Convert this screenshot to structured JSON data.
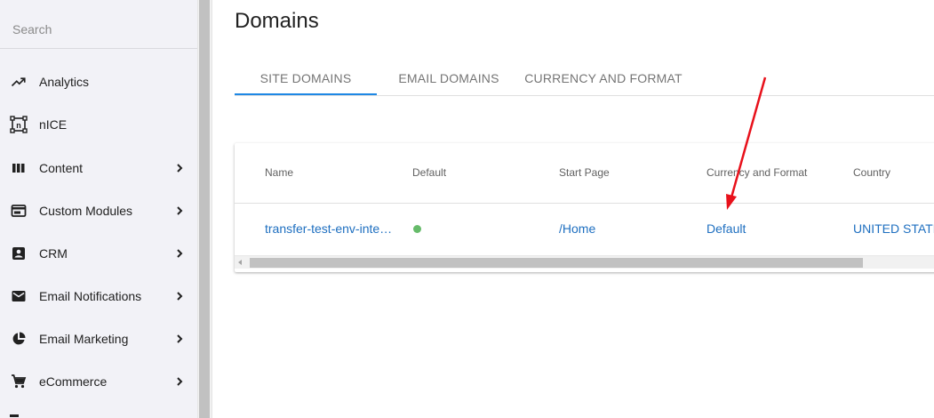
{
  "sidebar": {
    "search_placeholder": "Search",
    "items": [
      {
        "label": "Analytics",
        "icon": "trending-up-icon",
        "has_submenu": false
      },
      {
        "label": "nICE",
        "icon": "nice-icon",
        "has_submenu": false
      },
      {
        "label": "Content",
        "icon": "columns-icon",
        "has_submenu": true
      },
      {
        "label": "Custom Modules",
        "icon": "web-module-icon",
        "has_submenu": true
      },
      {
        "label": "CRM",
        "icon": "contact-card-icon",
        "has_submenu": true
      },
      {
        "label": "Email Notifications",
        "icon": "email-icon",
        "has_submenu": true
      },
      {
        "label": "Email Marketing",
        "icon": "pie-chart-icon",
        "has_submenu": true
      },
      {
        "label": "eCommerce",
        "icon": "cart-icon",
        "has_submenu": true
      }
    ]
  },
  "page": {
    "title": "Domains"
  },
  "tabs": [
    {
      "label": "SITE DOMAINS",
      "active": true
    },
    {
      "label": "EMAIL DOMAINS",
      "active": false
    },
    {
      "label": "CURRENCY AND FORMAT",
      "active": false
    }
  ],
  "table": {
    "columns": [
      "Name",
      "Default",
      "Start Page",
      "Currency and Format",
      "Country"
    ],
    "rows": [
      {
        "name": "transfer-test-env-inte…",
        "default": true,
        "start_page": "/Home",
        "currency_format": "Default",
        "country": "UNITED STATE"
      }
    ]
  },
  "colors": {
    "accent": "#1e88e5",
    "link": "#1e6fc0",
    "status_green": "#66bb6a",
    "annotation_arrow": "#e8111b",
    "sidebar_bg": "#f2f2f7"
  }
}
